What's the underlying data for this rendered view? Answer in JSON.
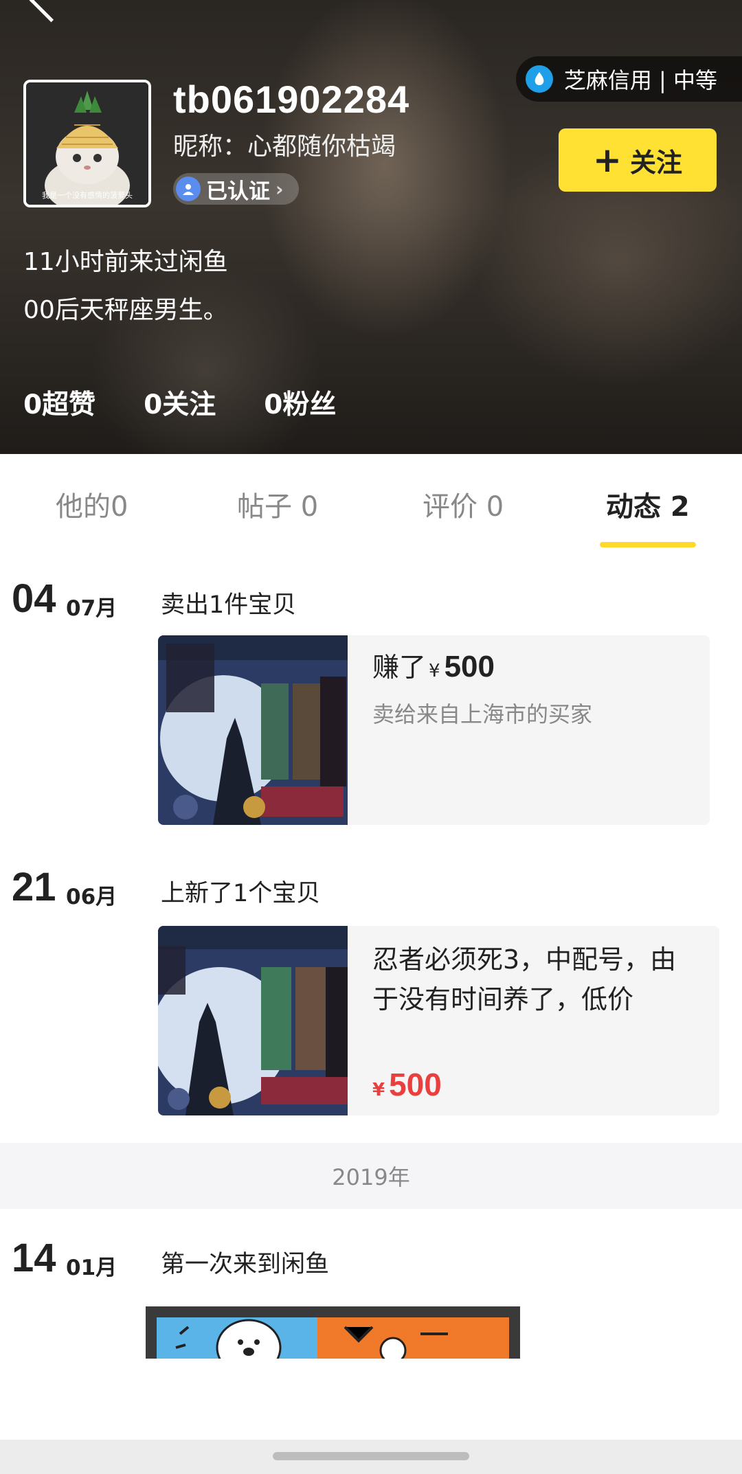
{
  "profile": {
    "username": "tb061902284",
    "nickname": "昵称：心都随你枯竭",
    "verified_label": "已认证",
    "credit_label": "芝麻信用 | 中等",
    "follow_label": "关注",
    "avatar_caption": "我是一个没有感情的菠萝头",
    "last_visit": "11小时前来过闲鱼",
    "bio": "00后天秤座男生。",
    "stats": [
      "0超赞",
      "0关注",
      "0粉丝"
    ]
  },
  "tabs": [
    "他的0",
    "帖子 0",
    "评价 0",
    "动态 2"
  ],
  "feed": [
    {
      "day": "04",
      "month": "07月",
      "title": "卖出1件宝贝",
      "earned_prefix": "赚了",
      "currency": "¥",
      "amount": "500",
      "buyer": "卖给来自上海市的买家"
    },
    {
      "day": "21",
      "month": "06月",
      "title": "上新了1个宝贝",
      "desc": "忍者必须死3，中配号，由于没有时间养了，低价",
      "currency": "¥",
      "price": "500"
    },
    {
      "day": "14",
      "month": "01月",
      "title": "第一次来到闲鱼"
    }
  ],
  "year_divider": "2019年",
  "colors": {
    "accent_yellow": "#ffe133",
    "price_red": "#ea3f3f",
    "credit_blue": "#1e9fe8"
  }
}
